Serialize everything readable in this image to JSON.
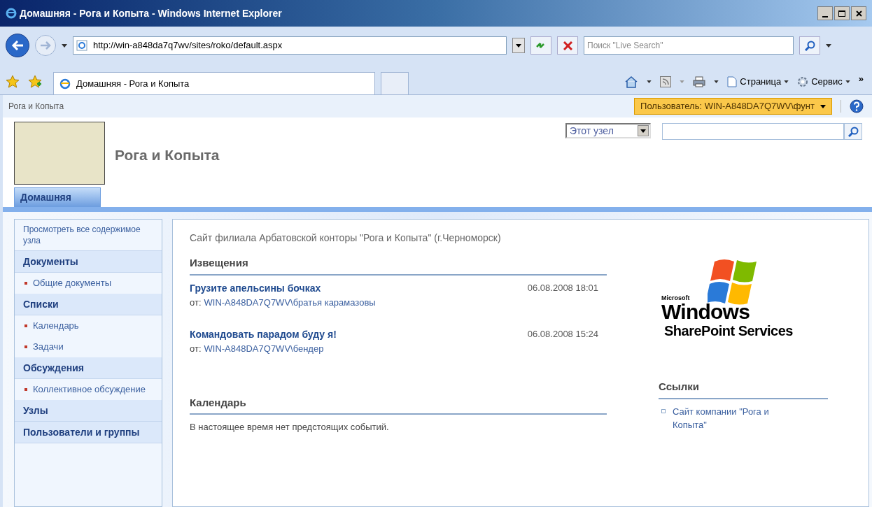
{
  "window": {
    "title": "Домашняя - Рога и Копыта - Windows Internet Explorer"
  },
  "address_bar": {
    "url": "http://win-a848da7q7wv/sites/roko/default.aspx"
  },
  "search_box": {
    "placeholder": "Поиск \"Live Search\""
  },
  "tabs": [
    {
      "label": "Домашняя - Рога и Копыта",
      "selected": true
    }
  ],
  "command_bar": {
    "page_menu": "Страница",
    "tools_menu": "Сервис",
    "more": "»"
  },
  "page": {
    "breadcrumb": "Рога и Копыта",
    "user_menu": "Пользователь: WIN-A848DA7Q7WV\\фунт",
    "site_title": "Рога и Копыта",
    "search_scope": "Этот узел",
    "top_nav": [
      {
        "label": "Домашняя",
        "selected": true
      }
    ],
    "quick_launch": [
      {
        "kind": "link",
        "label": "Просмотреть все содержимое узла"
      },
      {
        "kind": "heading",
        "label": "Документы"
      },
      {
        "kind": "item",
        "label": "Общие документы"
      },
      {
        "kind": "heading",
        "label": "Списки"
      },
      {
        "kind": "item",
        "label": "Календарь"
      },
      {
        "kind": "item",
        "label": "Задачи"
      },
      {
        "kind": "heading",
        "label": "Обсуждения"
      },
      {
        "kind": "item",
        "label": "Коллективное обсуждение"
      },
      {
        "kind": "heading",
        "label": "Узлы"
      },
      {
        "kind": "heading",
        "label": "Пользователи и группы"
      }
    ],
    "intro": "Сайт филиала Арбатовской конторы \"Рога и Копыта\" (г.Черноморск)",
    "announcements": {
      "title": "Извещения",
      "items": [
        {
          "title": "Грузите апельсины бочках",
          "date": "06.08.2008 18:01",
          "author_label": "от:",
          "author": "WIN-A848DA7Q7WV\\братья карамазовы"
        },
        {
          "title": "Командовать парадом буду я!",
          "date": "06.08.2008 15:24",
          "author_label": "от:",
          "author": "WIN-A848DA7Q7WV\\бендер"
        }
      ]
    },
    "calendar": {
      "title": "Календарь",
      "empty_text": "В настоящее время нет предстоящих событий."
    },
    "logo": {
      "brand": "Microsoft",
      "line1": "Windows",
      "line2": "SharePoint Services"
    },
    "links": {
      "title": "Ссылки",
      "items": [
        "Сайт компании \"Рога и Копыта\""
      ]
    }
  }
}
